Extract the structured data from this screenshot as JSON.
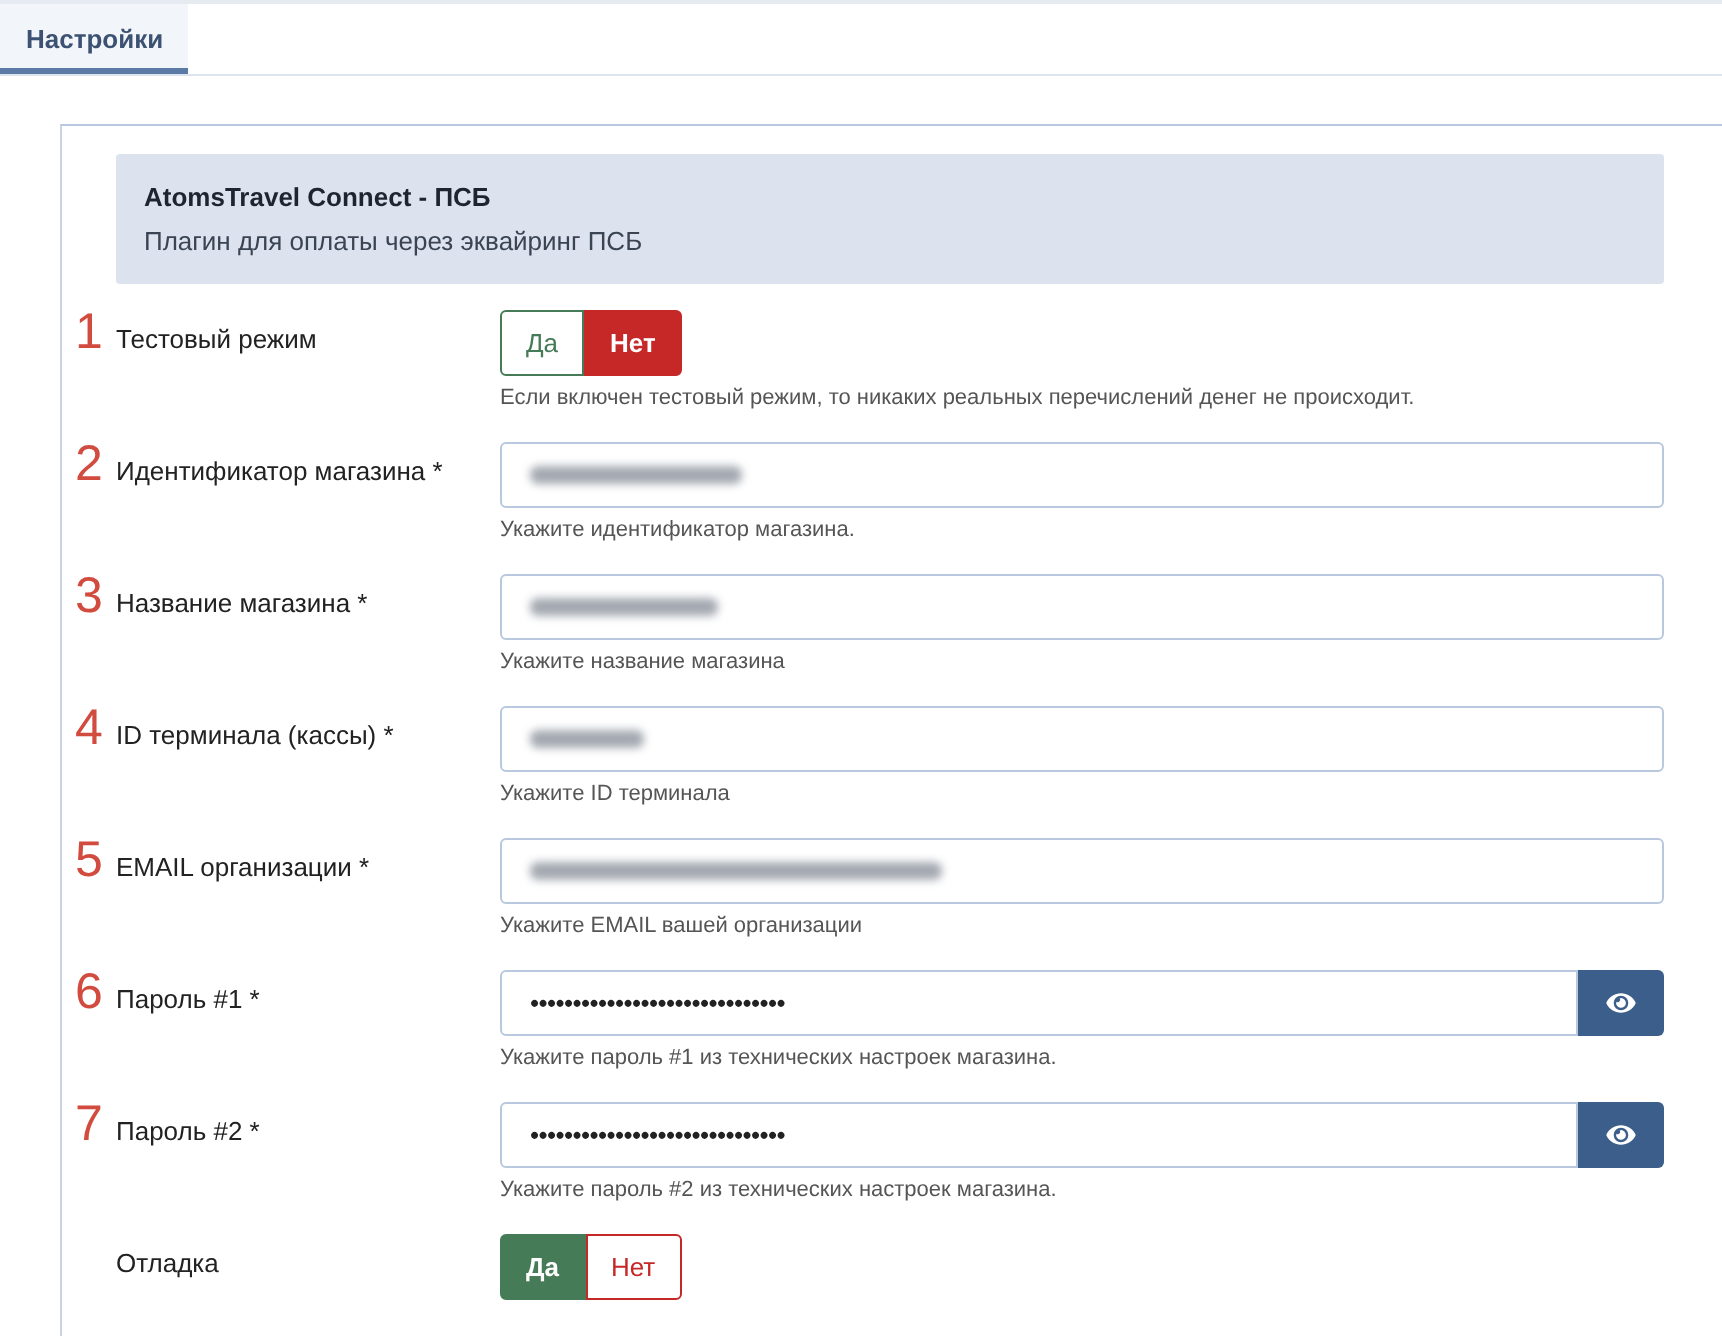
{
  "tabs": [
    {
      "label": "Настройки",
      "selected": true
    }
  ],
  "header": {
    "title": "AtomsTravel Connect - ПСБ",
    "description": "Плагин для оплаты через эквайринг ПСБ"
  },
  "fields": [
    {
      "number": "1",
      "label": "Тестовый режим",
      "kind": "toggle",
      "options": [
        {
          "label": "Да",
          "color": "#467b57",
          "selected": false
        },
        {
          "label": "Нет",
          "color": "#c62828",
          "selected": true
        }
      ],
      "hint": "Если включен тестовый режим, то никаких реальных перечислений денег не происходит."
    },
    {
      "number": "2",
      "label": "Идентификатор магазина *",
      "kind": "text",
      "redacted": true,
      "hint": "Укажите идентификатор магазина."
    },
    {
      "number": "3",
      "label": "Название магазина *",
      "kind": "text",
      "redacted": true,
      "hint": "Укажите название магазина"
    },
    {
      "number": "4",
      "label": "ID терминала (кассы) *",
      "kind": "text",
      "redacted": true,
      "hint": "Укажите ID терминала"
    },
    {
      "number": "5",
      "label": "EMAIL организации *",
      "kind": "text",
      "redacted": true,
      "hint": "Укажите EMAIL вашей организации"
    },
    {
      "number": "6",
      "label": "Пароль #1 *",
      "kind": "password",
      "value": "••••••••••••••••••••••••••••••",
      "hint": "Укажите пароль #1 из технических настроек магазина."
    },
    {
      "number": "7",
      "label": "Пароль #2 *",
      "kind": "password",
      "value": "••••••••••••••••••••••••••••••",
      "hint": "Укажите пароль #2 из технических настроек магазина."
    },
    {
      "label": "Отладка",
      "kind": "toggle",
      "options": [
        {
          "label": "Да",
          "color": "#467b57",
          "selected": true
        },
        {
          "label": "Нет",
          "color": "#c62828",
          "selected": false
        }
      ]
    }
  ]
}
